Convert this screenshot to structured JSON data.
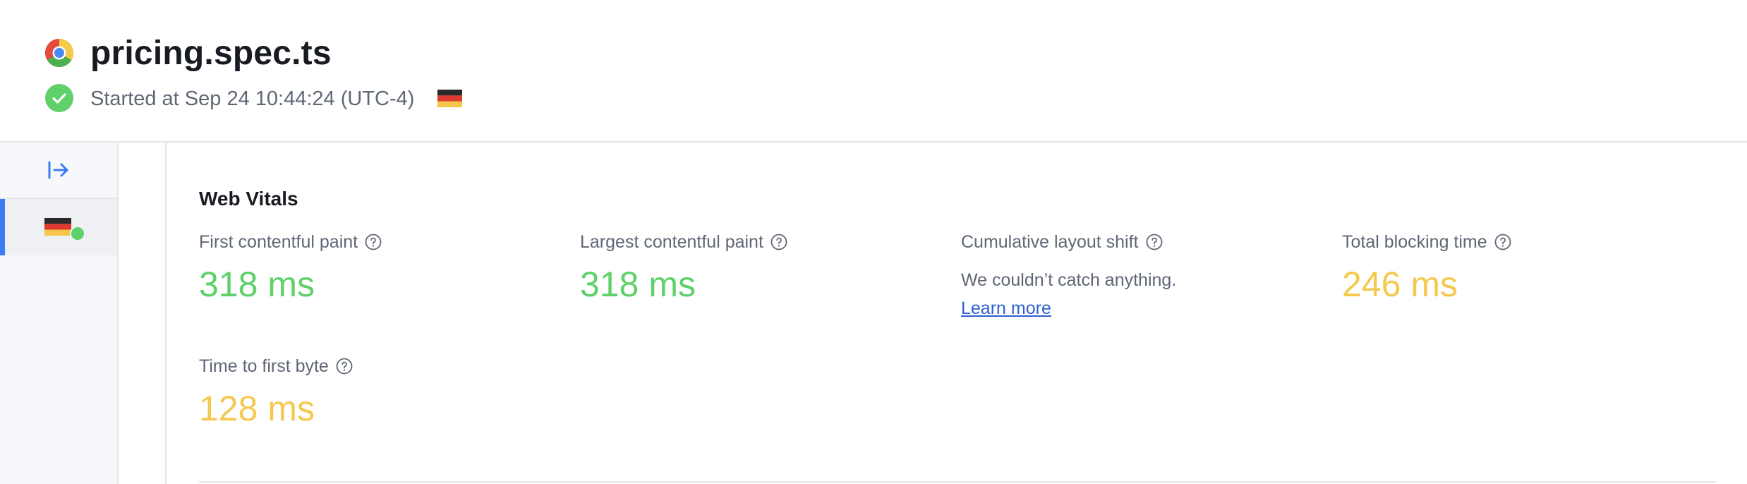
{
  "header": {
    "title": "pricing.spec.ts",
    "started": "Started at Sep 24 10:44:24 (UTC-4)",
    "browser_icon": "chrome-icon",
    "status_icon": "check-circle-icon",
    "flag": "germany-flag"
  },
  "sidebar": {
    "collapse_icon": "expand-arrow-icon",
    "run_item": {
      "flag": "germany-flag",
      "status": "passed"
    }
  },
  "web_vitals": {
    "title": "Web Vitals",
    "metrics": [
      {
        "label": "First contentful paint",
        "value": "318 ms",
        "rating": "good"
      },
      {
        "label": "Largest contentful paint",
        "value": "318 ms",
        "rating": "good"
      },
      {
        "label": "Cumulative layout shift",
        "empty_text": "We couldn’t catch anything.",
        "link": "Learn more"
      },
      {
        "label": "Total blocking time",
        "value": "246 ms",
        "rating": "needs-improvement"
      },
      {
        "label": "Time to first byte",
        "value": "128 ms",
        "rating": "needs-improvement"
      }
    ]
  },
  "colors": {
    "good": "#5fd06a",
    "needs_improvement": "#f5c94f",
    "accent": "#3b7cf4",
    "link": "#2f5fcf"
  }
}
